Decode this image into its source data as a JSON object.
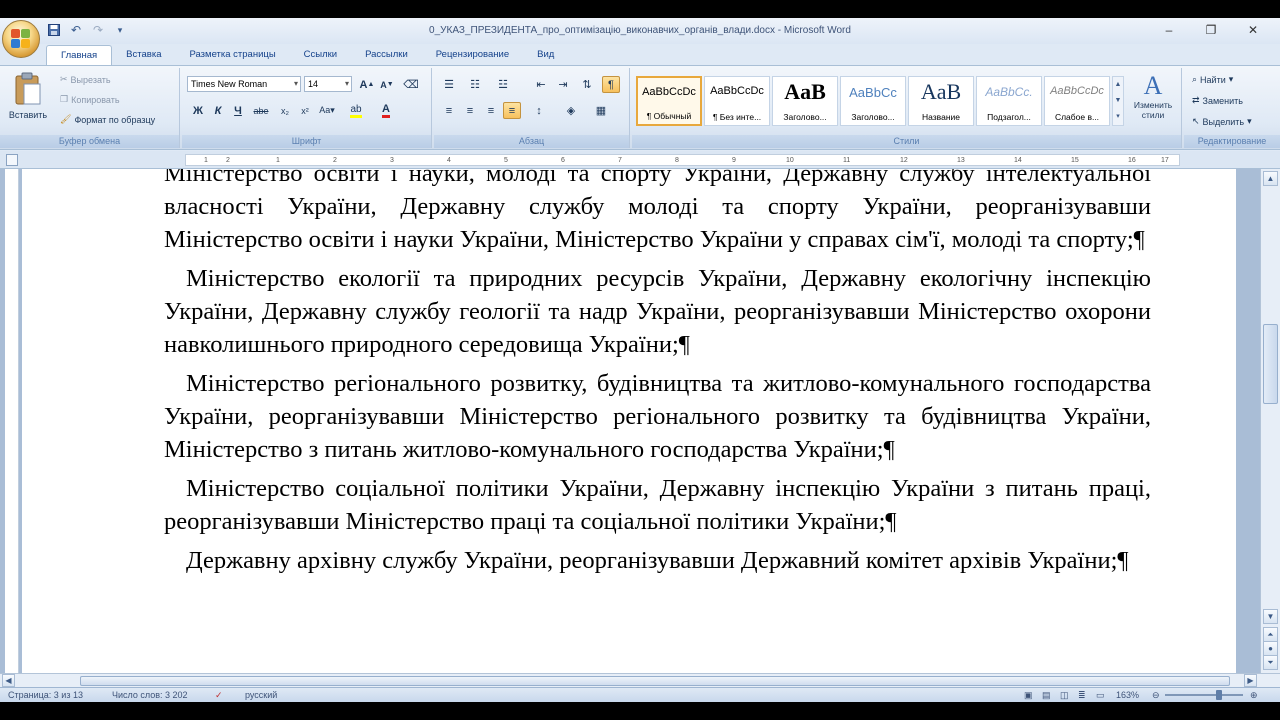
{
  "window": {
    "title": "0_УКАЗ_ПРЕЗИДЕНТА_про_оптимізацію_виконавчих_органів_влади.docx - Microsoft Word",
    "controls": [
      "–",
      "❐",
      "✕"
    ]
  },
  "tabs": [
    "Главная",
    "Вставка",
    "Разметка страницы",
    "Ссылки",
    "Рассылки",
    "Рецензирование",
    "Вид"
  ],
  "ribbon": {
    "clipboard": {
      "paste_label": "Вставить",
      "cut_label": "Вырезать",
      "copy_label": "Копировать",
      "format_painter_label": "Формат по образцу",
      "group_label": "Буфер обмена"
    },
    "font": {
      "font_name": "Times New Roman",
      "font_size": "14",
      "group_label": "Шрифт"
    },
    "paragraph": {
      "group_label": "Абзац"
    },
    "styles": {
      "group_label": "Стили",
      "items": [
        {
          "sample": "AaBbCcDc",
          "name": "¶ Обычный"
        },
        {
          "sample": "AaBbCcDc",
          "name": "¶ Без инте..."
        },
        {
          "sample": "AaB",
          "name": "Заголово..."
        },
        {
          "sample": "AaBbCc",
          "name": "Заголово..."
        },
        {
          "sample": "AaB",
          "name": "Название"
        },
        {
          "sample": "AaBbCc.",
          "name": "Подзагол..."
        },
        {
          "sample": "AaBbCcDc",
          "name": "Слабое в..."
        }
      ],
      "change_styles_label": "Изменить стили"
    },
    "editing": {
      "find_label": "Найти",
      "replace_label": "Заменить",
      "select_label": "Выделить",
      "group_label": "Редактирование"
    }
  },
  "ruler_ticks": [
    "1",
    "2",
    "1",
    "2",
    "3",
    "4",
    "5",
    "6",
    "7",
    "8",
    "9",
    "10",
    "11",
    "12",
    "13",
    "14",
    "15",
    "16",
    "17"
  ],
  "document": {
    "paragraphs": [
      "Міністерство освіти і науки, молоді та спорту України, Державну службу інтелектуальної власності України, Державну службу молоді та спорту України, реорганізувавши Міністерство освіти і науки України, Міністерство України у справах сім'ї, молоді та спорту;¶",
      "Міністерство екології та природних ресурсів України, Державну екологічну інспекцію України, Державну службу геології та надр України, реорганізувавши Міністерство охорони навколишнього природного середовища України;¶",
      "Міністерство регіонального розвитку, будівництва та житлово-комунального господарства України, реорганізувавши Міністерство регіонального розвитку та будівництва України, Міністерство з питань житлово-комунального господарства України;¶",
      "Міністерство соціальної політики України, Державну інспекцію України з питань праці, реорганізувавши Міністерство праці та соціальної політики України;¶",
      "Державну архівну службу України, реорганізувавши Державний комітет архівів України;¶"
    ]
  },
  "statusbar": {
    "page": "Страница: 3 из 13",
    "words": "Число слов: 3 202",
    "language": "русский",
    "zoom": "163%"
  },
  "colors": {
    "ribbon_bg": "#dfe9f5",
    "spell_underline": "#e0484f",
    "active_style": "#e8a83c"
  }
}
